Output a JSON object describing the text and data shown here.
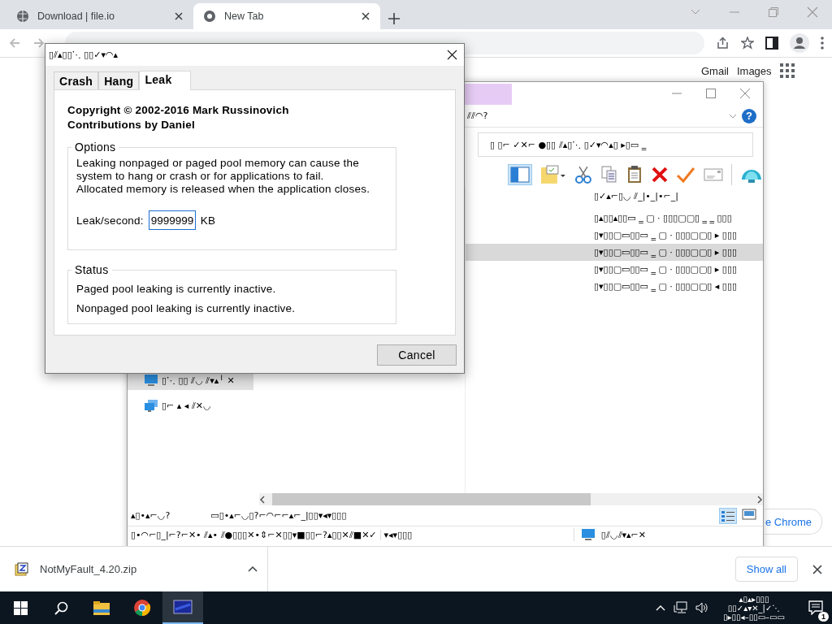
{
  "browser": {
    "tabs": [
      {
        "title": "Download | file.io",
        "selected": false
      },
      {
        "title": "New Tab",
        "selected": true
      }
    ],
    "links": [
      "Gmail",
      "Images"
    ],
    "customize_button": "e Chrome"
  },
  "explorer": {
    "header_label": "⫽⫽◠?",
    "help_glyph": "?",
    "address": "▯   ▯⌐ ✓✕⌐ ●▯▯ ⫽▴▯⋱ ▯✓▾◠▴▯ ▸▯▭ ‗",
    "column_header": "▯✓▴⌐▯◡ ⫽_|•_|•⌐_|",
    "rows": [
      {
        "text": "▯▴▯▯▴▯▯▭ ‗ ▢ · ▯▯▯▢▢▯ ‗ ‗ ▯▯▯",
        "selected": false
      },
      {
        "text": "▯▾▯▯▢▭▯▯▭ ‗ ▢ · ▯▯▯▢▢▯ ▸ ▯▯▯",
        "selected": false
      },
      {
        "text": "▯▾▯▯▢▭▯▯▭ ‗ ▢ · ▯▯▯▢▢▯ ▸ ▯▯▯",
        "selected": true
      },
      {
        "text": "▯▾▯▯▢▭▯▯▭ ‗ ▢ · ▯▯▯▢▢▯ ▸ ▯▯▯",
        "selected": false
      },
      {
        "text": "▯▾▯▯▢▭▯▯▭ ‗ ▢ · ▯▯▯▢▢▯ ◂ ▯▯▯",
        "selected": false
      }
    ],
    "tree": [
      {
        "kind": "computer",
        "label": "▯⋱ ▯▯ ⫽◡ ⫽▾▴╵ ✕",
        "selected": true
      },
      {
        "kind": "network",
        "label": "▯⌐ ▴ ◂ ⫽✕◡",
        "selected": false
      }
    ],
    "status_texts": [
      "▴▯•▴⌐◡?",
      "▭▯•▴⌐◡▯?⌐◠⌐⌐▴⌐_|▯▯▾◂▾▯▯▯"
    ],
    "status_bar": [
      "▯•◠⌐▯_|⌐?⌐✕• ⫽▴• ⫽●▯▯▯✕•⇕⌐✕▯▯▾■▯▯⌐?▴▯▯✕⫽■✕✓",
      "▾◂▾▯▯▯",
      "▯⫽◡⫽▾▴⌐✕"
    ]
  },
  "dialog": {
    "title": "▯⫽▴▯▯⋱ ▯▯✓▾◠▴",
    "tabs": [
      {
        "label": "Crash",
        "selected": false
      },
      {
        "label": "Hang",
        "selected": false
      },
      {
        "label": "Leak",
        "selected": true
      }
    ],
    "copyright": "Copyright © 2002-2016 Mark Russinovich",
    "contributions": "Contributions by Daniel",
    "options": {
      "legend": "Options",
      "description": "Leaking nonpaged or paged pool memory can cause the system to hang or crash or for applications to fail.",
      "note": "Allocated memory is released when the application closes.",
      "field_label": "Leak/second:",
      "field_value": "9999999",
      "unit": "KB"
    },
    "status": {
      "legend": "Status",
      "lines": [
        "Paged pool leaking is currently inactive.",
        "Nonpaged pool leaking is currently inactive."
      ]
    },
    "cancel": "Cancel"
  },
  "downloads": {
    "file": "NotMyFault_4.20.zip",
    "show_all": "Show all"
  },
  "taskbar": {
    "apps": [
      {
        "kind": "folder",
        "active": false
      },
      {
        "kind": "chrome",
        "active": false
      },
      {
        "kind": "app",
        "active": true
      }
    ],
    "clock": [
      "▴▯▴▸▯▯▯",
      "▯▯✓▴▾✕_|✓⋱",
      "▯▸▯▯◂–▯▯▭–▭▭"
    ],
    "notification_count": "1"
  }
}
